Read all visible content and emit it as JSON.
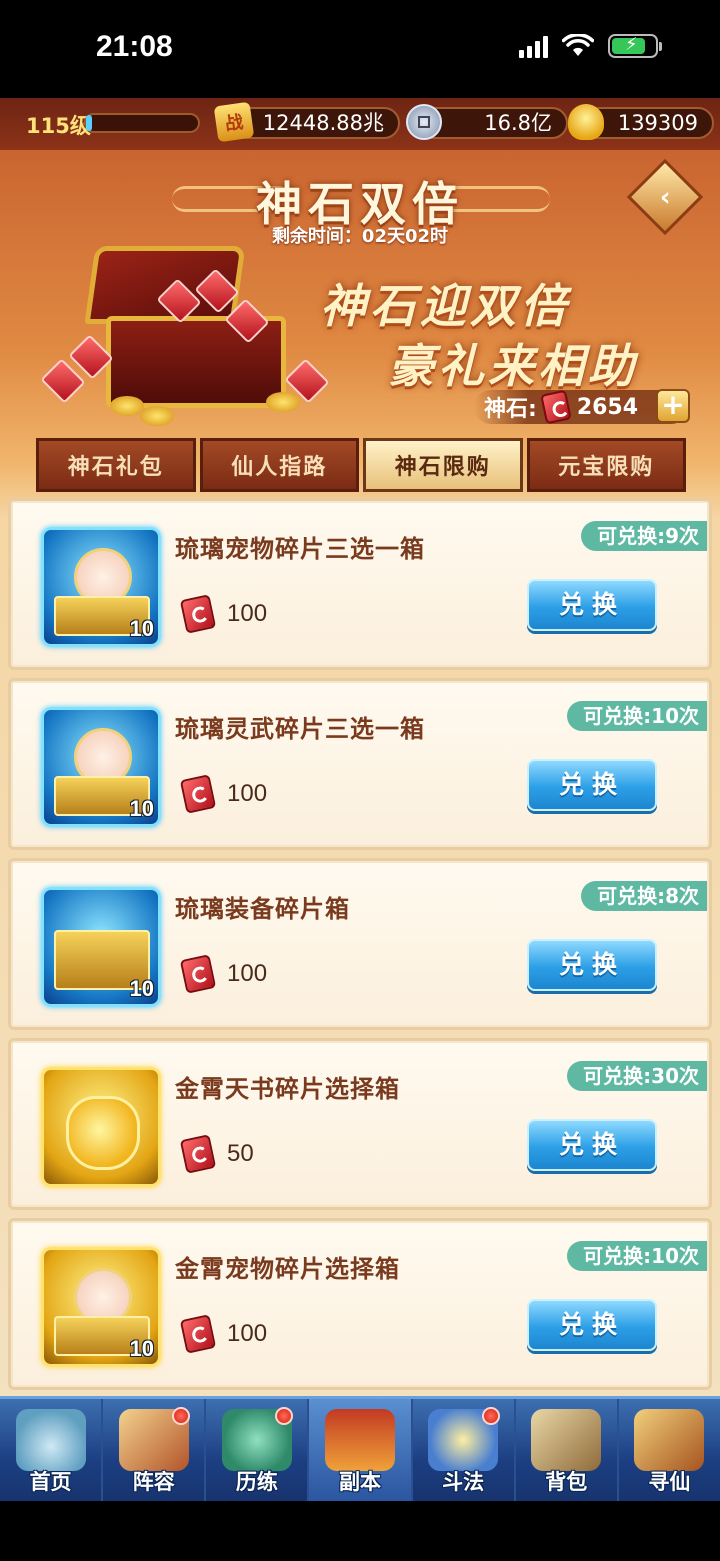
{
  "status_bar": {
    "time": "21:08"
  },
  "top_resources": {
    "level": "115级",
    "exp_fraction": 0.05,
    "power_icon": "战",
    "power": "12448.88兆",
    "coin": "16.8亿",
    "ingot": "139309"
  },
  "banner": {
    "title": "神石双倍",
    "timer": "剩余时间：02天02时",
    "slogan_line1": "神石迎双倍",
    "slogan_line2": "豪礼来相助",
    "stone_label": "神石:",
    "stone_count": "2654",
    "plus_label": "+"
  },
  "tabs": [
    {
      "label": "神石礼包",
      "active": false
    },
    {
      "label": "仙人指路",
      "active": false
    },
    {
      "label": "神石限购",
      "active": true
    },
    {
      "label": "元宝限购",
      "active": false
    }
  ],
  "items": [
    {
      "name": "琉璃宠物碎片三选一箱",
      "qty": "10",
      "price": "100",
      "limit": "可兑换:9次",
      "button": "兑换",
      "icon": "blue-chest-pet-icon"
    },
    {
      "name": "琉璃灵武碎片三选一箱",
      "qty": "10",
      "price": "100",
      "limit": "可兑换:10次",
      "button": "兑换",
      "icon": "blue-chest-weapon-icon"
    },
    {
      "name": "琉璃装备碎片箱",
      "qty": "10",
      "price": "100",
      "limit": "可兑换:8次",
      "button": "兑换",
      "icon": "blue-chest-equipment-icon"
    },
    {
      "name": "金霄天书碎片选择箱",
      "qty": "",
      "price": "50",
      "limit": "可兑换:30次",
      "button": "兑换",
      "icon": "gold-bag-icon"
    },
    {
      "name": "金霄宠物碎片选择箱",
      "qty": "10",
      "price": "100",
      "limit": "可兑换:10次",
      "button": "兑换",
      "icon": "gold-chest-pet-icon"
    }
  ],
  "nav": [
    {
      "label": "首页",
      "dot": false
    },
    {
      "label": "阵容",
      "dot": true
    },
    {
      "label": "历练",
      "dot": true
    },
    {
      "label": "副本",
      "dot": false
    },
    {
      "label": "斗法",
      "dot": true
    },
    {
      "label": "背包",
      "dot": false
    },
    {
      "label": "寻仙",
      "dot": false
    }
  ],
  "colors": {
    "accent_blue": "#2c9fe6",
    "limit_badge": "#5fb9a2",
    "title_brown": "#7a3a1e"
  }
}
